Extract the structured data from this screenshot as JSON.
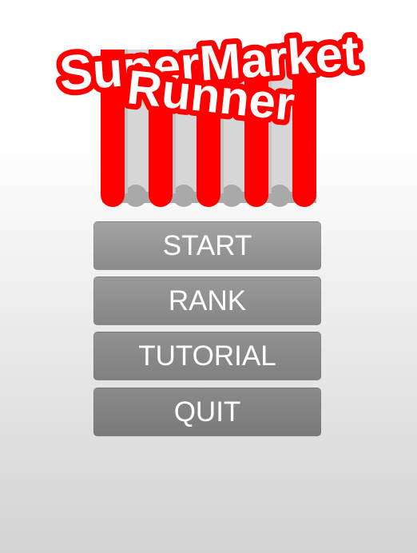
{
  "logo": {
    "line1": "SuperMarket",
    "line2": "Runner",
    "text_color": "#ffffff",
    "outline_color": "#ff0000",
    "awning_red": "#ff0000",
    "awning_gray": "#d6d6d6"
  },
  "menu": {
    "start": "START",
    "rank": "RANK",
    "tutorial": "TUTORIAL",
    "quit": "QUIT"
  }
}
